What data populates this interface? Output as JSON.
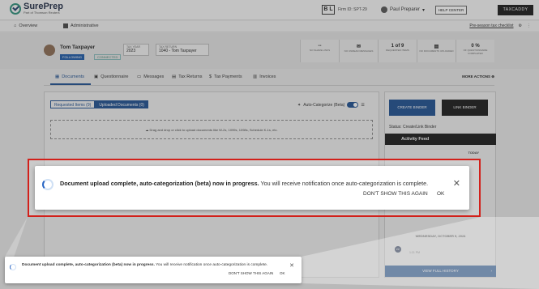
{
  "logo": {
    "name": "SurePrep",
    "sub": "Part of Thomson Reuters"
  },
  "header": {
    "firm_badge": "B L",
    "firm_id": "Firm ID: SPT-29",
    "user": "Paul Preparer",
    "help": "HELP CENTER",
    "taxcaddy": "TAXCADDY"
  },
  "subnav": {
    "overview": "Overview",
    "administrative": "Administrative",
    "checklist": "Pre-season tax checklist"
  },
  "client": {
    "name": "Tom Taxpayer",
    "following": "FOLLOWING",
    "connected": "CONNECTED",
    "tax_year_label": "TAX YEAR",
    "tax_year": "2023",
    "tax_return_label": "TAX RETURN",
    "tax_return": "1040 - Tom Taxpayer",
    "stats": [
      {
        "value": "--",
        "label": "NO SHARE LINKS"
      },
      {
        "value": "",
        "label": "NO UNREAD MESSAGES"
      },
      {
        "value": "1 of 9",
        "label": "REQUESTED ITEMS"
      },
      {
        "value": "",
        "label": "NO DOCUMENTS UPLOADED"
      },
      {
        "value": "0 %",
        "label": "OF QUESTIONNAIRE COMPLETED"
      }
    ]
  },
  "tabs": {
    "documents": "Documents",
    "questionnaire": "Questionnaire",
    "messages": "Messages",
    "tax_returns": "Tax Returns",
    "tax_payments": "Tax Payments",
    "invoices": "Invoices",
    "more_actions": "MORE ACTIONS"
  },
  "panel": {
    "requested_items": "Requested Items (9)",
    "uploaded_documents": "Uploaded Documents (0)",
    "auto_categorize": "Auto-Categorize (Beta)",
    "dropzone": "Drag and drop or click to upload documents like W-2s, 1099s, 1098s, Schedule K-1s, etc."
  },
  "sidebar": {
    "create_binder": "CREATE BINDER",
    "link_binder": "LINK BINDER",
    "status": "Status: Create/Link Binder",
    "activity_feed": "Activity Feed",
    "today": "TODAY",
    "date": "WEDNESDAY, OCTOBER 9, 2024",
    "avatar_initials": "PP",
    "time": "1:21 PM",
    "view_history": "VIEW FULL HISTORY"
  },
  "toast": {
    "bold": "Document upload complete, auto-categorization (beta) now in progress.",
    "rest": " You will receive notification once auto-categorization is complete.",
    "dont_show": "DON'T SHOW THIS AGAIN",
    "ok": "OK"
  },
  "colors": {
    "accent": "#1e4f90",
    "highlight": "#d2201a",
    "dark": "#1a1a1a"
  }
}
